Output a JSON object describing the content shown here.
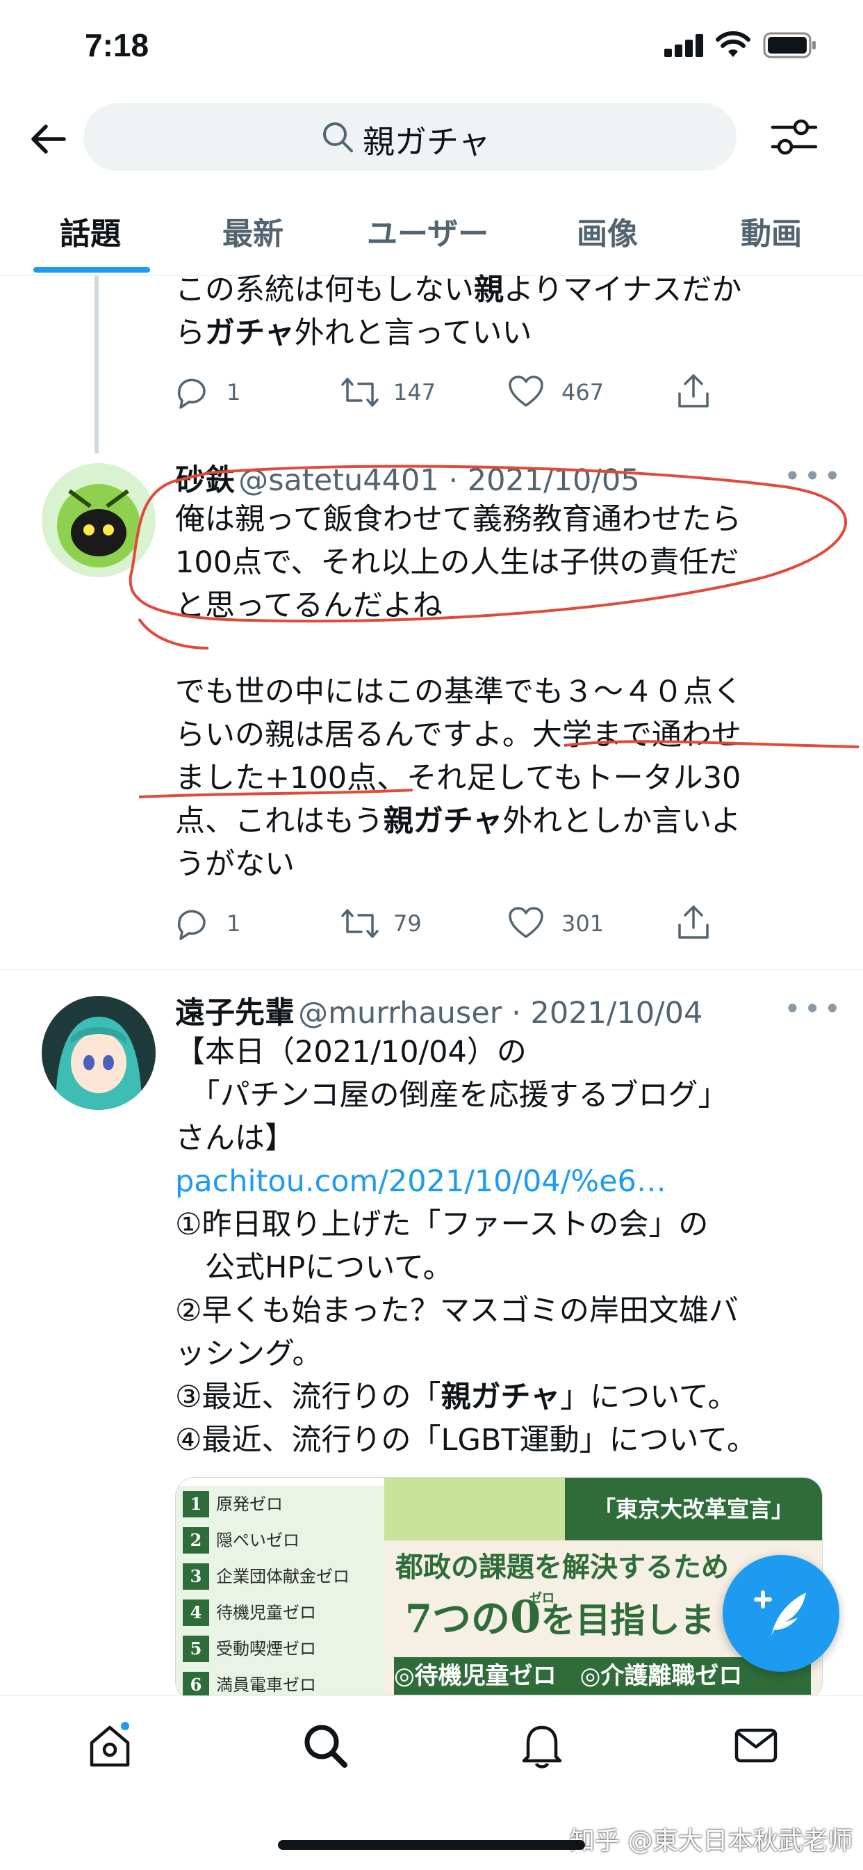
{
  "status_bar": {
    "time": "7:18"
  },
  "search": {
    "query": "親ガチャ"
  },
  "tabs": [
    {
      "label": "話題",
      "active": true
    },
    {
      "label": "最新",
      "active": false
    },
    {
      "label": "ユーザー",
      "active": false
    },
    {
      "label": "画像",
      "active": false
    },
    {
      "label": "動画",
      "active": false
    }
  ],
  "tweets": [
    {
      "body_lines": [
        [
          {
            "t": "この系統は何もしない"
          },
          {
            "t": "親",
            "b": true
          },
          {
            "t": "よりマイナスだか"
          }
        ],
        [
          {
            "t": "ら"
          },
          {
            "t": "ガチャ",
            "b": true
          },
          {
            "t": "外れと言っていい"
          }
        ]
      ],
      "replies": "1",
      "retweets": "147",
      "likes": "467"
    },
    {
      "name": "砂鉄",
      "handle_date": "@satetu4401 · 2021/10/05",
      "body_lines": [
        [
          {
            "t": "俺は親って飯食わせて義務教育通わせたら"
          }
        ],
        [
          {
            "t": "100点で、それ以上の人生は子供の責任だ"
          }
        ],
        [
          {
            "t": "と思ってるんだよね"
          }
        ],
        [
          {
            "t": " "
          }
        ],
        [
          {
            "t": "でも世の中にはこの基準でも３〜４０点く"
          }
        ],
        [
          {
            "t": "らいの親は居るんですよ。大学まで通わせ"
          }
        ],
        [
          {
            "t": "ました+100点、それ足してもトータル30"
          }
        ],
        [
          {
            "t": "点、これはもう"
          },
          {
            "t": "親ガチャ",
            "b": true
          },
          {
            "t": "外れとしか言いよ"
          }
        ],
        [
          {
            "t": "うがない"
          }
        ]
      ],
      "replies": "1",
      "retweets": "79",
      "likes": "301"
    },
    {
      "name": "遠子先輩",
      "handle_date": "@murrhauser · 2021/10/04",
      "body_lines": [
        [
          {
            "t": "【本日（2021/10/04）の"
          }
        ],
        [
          {
            "t": "　「パチンコ屋の倒産を応援するブログ」"
          }
        ],
        [
          {
            "t": "さんは】"
          }
        ],
        [
          {
            "t": "pachitou.com/2021/10/04/%e6…",
            "link": true
          }
        ],
        [
          {
            "t": "①昨日取り上げた「ファーストの会」の"
          }
        ],
        [
          {
            "t": "　公式HPについて。"
          }
        ],
        [
          {
            "t": "②早くも始まった？マスゴミの岸田文雄バ"
          }
        ],
        [
          {
            "t": "ッシング。"
          }
        ],
        [
          {
            "t": "③最近、流行りの「"
          },
          {
            "t": "親ガチャ",
            "b": true
          },
          {
            "t": "」について。"
          }
        ],
        [
          {
            "t": "④最近、流行りの「LGBT運動」について。"
          }
        ]
      ],
      "media": {
        "list": [
          "原発ゼロ",
          "隠ぺいゼロ",
          "企業団体献金ゼロ",
          "待機児童ゼロ",
          "受動喫煙ゼロ",
          "満員電車ゼロ"
        ],
        "banner": "「東京大改革宣言」",
        "headline": "都政の課題を解決するため",
        "subhead_a": "7つの",
        "subhead_zero": "0",
        "subhead_ruby": "ゼロ",
        "subhead_b": "を目指しま",
        "tag1": "◎待機児童ゼロ",
        "tag2": "◎介護離職ゼロ"
      }
    }
  ],
  "watermark": "知乎 @東大日本秋武老师",
  "colors": {
    "accent": "#1d9bf0",
    "annotation_red": "#e04a3a"
  }
}
